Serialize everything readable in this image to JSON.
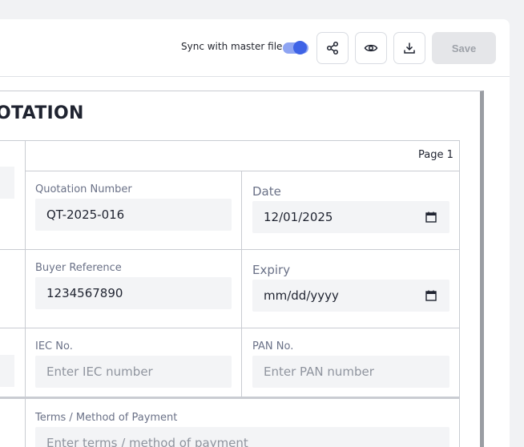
{
  "toolbar": {
    "sync_label": "Sync with master file",
    "sync_on": true,
    "share_icon": "share-icon",
    "preview_icon": "eye-icon",
    "download_icon": "download-icon",
    "save_label": "Save"
  },
  "document": {
    "title": "OTATION",
    "page_label": "Page 1",
    "fields": {
      "quotation_number": {
        "label": "Quotation Number",
        "value": "QT-2025-016"
      },
      "date": {
        "label": "Date",
        "value": "12/01/2025"
      },
      "buyer_reference": {
        "label": "Buyer Reference",
        "value": "1234567890"
      },
      "expiry": {
        "label": "Expiry",
        "placeholder": "mm/dd/yyyy"
      },
      "iec_no": {
        "label": "IEC No.",
        "placeholder": "Enter IEC number"
      },
      "pan_no": {
        "label": "PAN No.",
        "placeholder": "Enter PAN number"
      },
      "terms": {
        "label": "Terms / Method of Payment",
        "placeholder": "Enter terms / method of payment"
      }
    }
  },
  "colors": {
    "accent": "#3e63e6",
    "toggle_track": "#8ea4f2",
    "field_bg": "#f3f4f6",
    "save_disabled_bg": "#e5e6e9"
  }
}
